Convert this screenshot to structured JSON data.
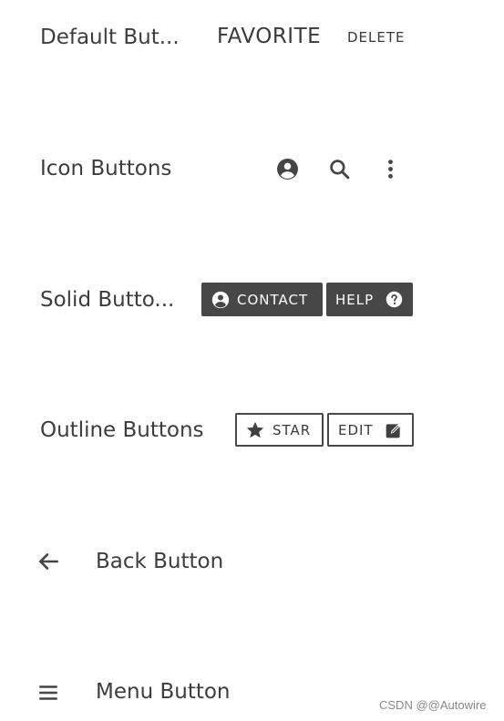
{
  "default_row": {
    "label": "Default But...",
    "favorite_label": "FAVORITE",
    "delete_label": "DELETE"
  },
  "icon_row": {
    "label": "Icon Buttons",
    "icons": [
      "account-circle-icon",
      "search-icon",
      "more-vert-icon"
    ]
  },
  "solid_row": {
    "label": "Solid Butto...",
    "contact_label": "CONTACT",
    "help_label": "HELP"
  },
  "outline_row": {
    "label": "Outline Buttons",
    "star_label": "STAR",
    "edit_label": "EDIT"
  },
  "back_row": {
    "label": "Back Button"
  },
  "menu_row": {
    "label": "Menu Button"
  },
  "watermark": "CSDN @@Autowire",
  "colors": {
    "text": "#3d3d3d",
    "solid_bg": "#474747",
    "solid_text": "#ffffff",
    "outline_border": "#474747",
    "background": "#ffffff"
  }
}
